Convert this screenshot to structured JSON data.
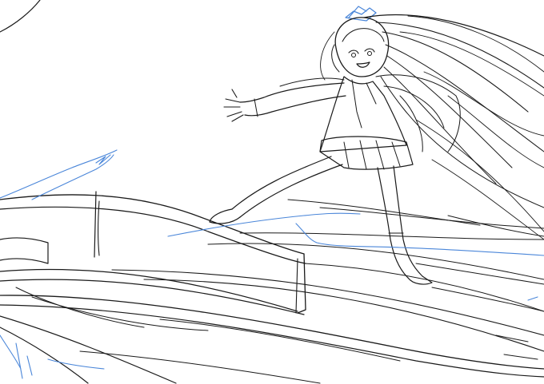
{
  "artwork": {
    "ink_color": "#1a1a1a",
    "accent_color": "#4a86d9",
    "background_color": "#ffffff"
  }
}
